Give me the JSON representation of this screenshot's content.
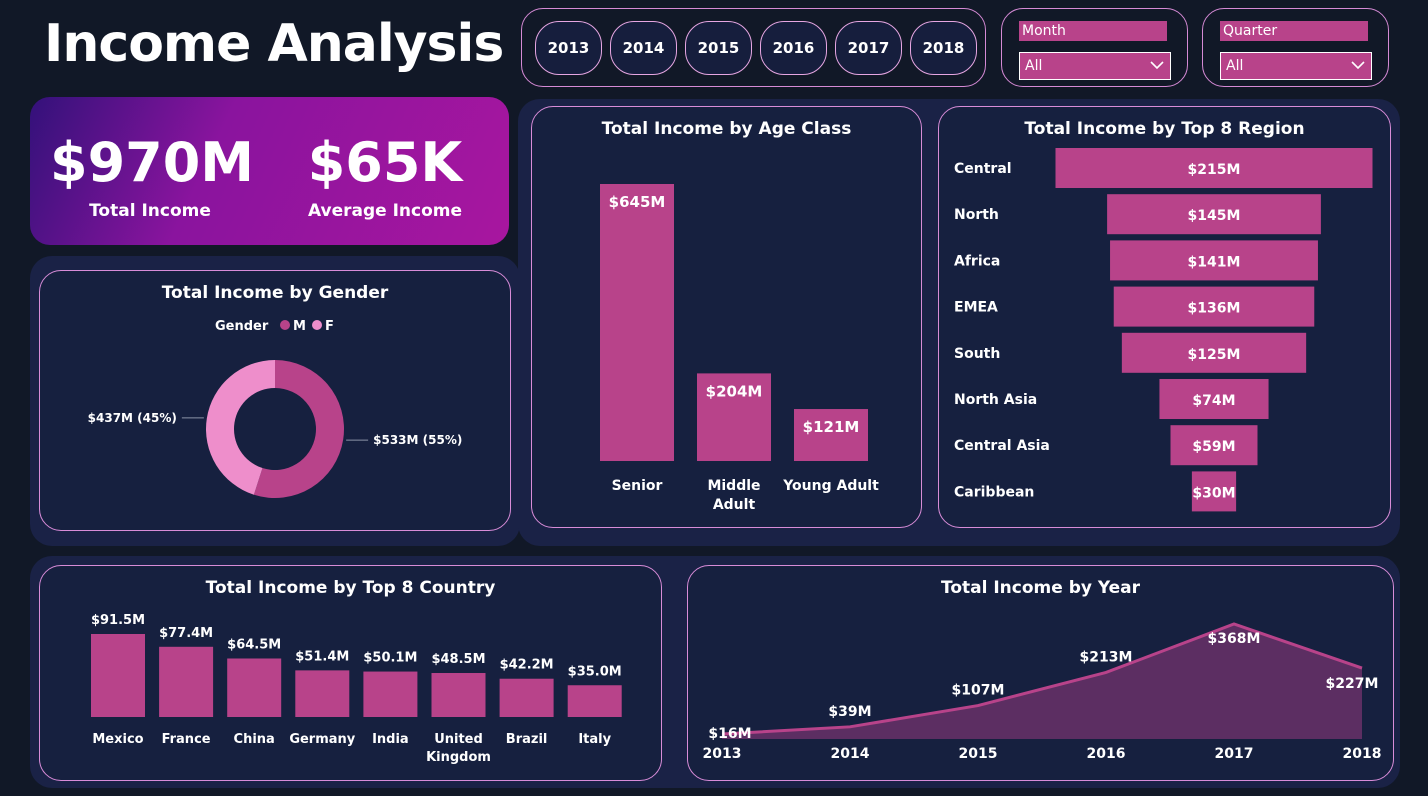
{
  "header": {
    "title": "Income Analysis"
  },
  "year_filter": [
    "2013",
    "2014",
    "2015",
    "2016",
    "2017",
    "2018"
  ],
  "filters": {
    "month": {
      "label": "Month",
      "value": "All"
    },
    "quarter": {
      "label": "Quarter",
      "value": "All"
    }
  },
  "kpis": {
    "total_income": {
      "value": "$970M",
      "label": "Total Income"
    },
    "average_income": {
      "value": "$65K",
      "label": "Average Income"
    }
  },
  "colors": {
    "accent": "#b8438a",
    "accent_light": "#ee8ecb",
    "background": "#111827",
    "panel": "#16203f",
    "border": "#d88cd8"
  },
  "chart_data": [
    {
      "type": "pie",
      "title": "Total Income by Gender",
      "legend_title": "Gender",
      "legend_position": "top",
      "categories": [
        "M",
        "F"
      ],
      "values": [
        533,
        437
      ],
      "percents": [
        55,
        45
      ],
      "labels": [
        "$533M (55%)",
        "$437M (45%)"
      ],
      "colors": [
        "#b8438a",
        "#ee8ecb"
      ]
    },
    {
      "type": "bar",
      "title": "Total Income by Age Class",
      "categories": [
        "Senior",
        "Middle Adult",
        "Young Adult"
      ],
      "values": [
        645,
        204,
        121
      ],
      "labels": [
        "$645M",
        "$204M",
        "$121M"
      ]
    },
    {
      "type": "bar",
      "orientation": "funnel",
      "title": "Total Income by Top 8 Region",
      "categories": [
        "Central",
        "North",
        "Africa",
        "EMEA",
        "South",
        "North Asia",
        "Central Asia",
        "Caribbean"
      ],
      "values": [
        215,
        145,
        141,
        136,
        125,
        74,
        59,
        30
      ],
      "labels": [
        "$215M",
        "$145M",
        "$141M",
        "$136M",
        "$125M",
        "$74M",
        "$59M",
        "$30M"
      ]
    },
    {
      "type": "bar",
      "title": "Total Income by Top 8 Country",
      "categories": [
        "Mexico",
        "France",
        "China",
        "Germany",
        "India",
        "United Kingdom",
        "Brazil",
        "Italy"
      ],
      "category_lines": [
        [
          "Mexico"
        ],
        [
          "France"
        ],
        [
          "China"
        ],
        [
          "Germany"
        ],
        [
          "India"
        ],
        [
          "United",
          "Kingdom"
        ],
        [
          "Brazil"
        ],
        [
          "Italy"
        ]
      ],
      "values": [
        91.5,
        77.4,
        64.5,
        51.4,
        50.1,
        48.5,
        42.2,
        35.0
      ],
      "labels": [
        "$91.5M",
        "$77.4M",
        "$64.5M",
        "$51.4M",
        "$50.1M",
        "$48.5M",
        "$42.2M",
        "$35.0M"
      ]
    },
    {
      "type": "area",
      "title": "Total Income by Year",
      "x": [
        "2013",
        "2014",
        "2015",
        "2016",
        "2017",
        "2018"
      ],
      "values": [
        16,
        39,
        107,
        213,
        368,
        227
      ],
      "labels": [
        "$16M",
        "$39M",
        "$107M",
        "$213M",
        "$368M",
        "$227M"
      ]
    }
  ]
}
